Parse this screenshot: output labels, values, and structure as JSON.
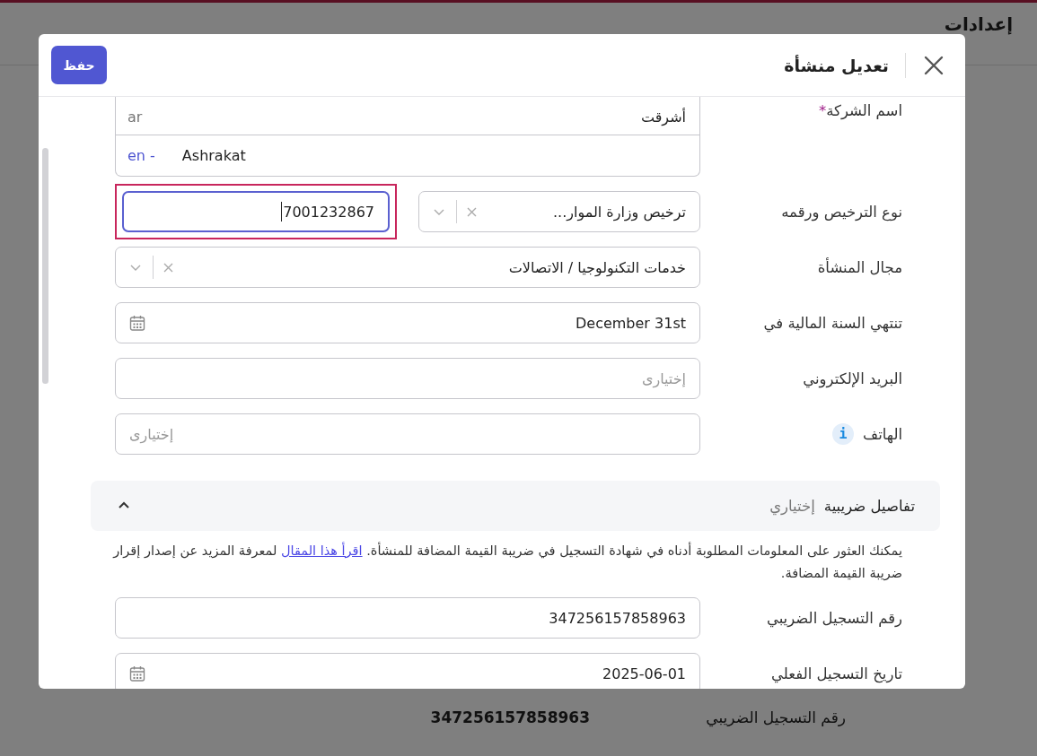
{
  "page": {
    "title": "إعدادات",
    "rows": [
      {
        "label": "رقم التسجيل الضريبي",
        "value": "347256157858963"
      }
    ]
  },
  "dialog": {
    "title": "تعديل منشأة",
    "save_button": "حفظ",
    "fields": [
      {
        "kind": "multilang",
        "label": "اسم الشركة",
        "required_mark": "*",
        "entries": [
          {
            "lang": "ar",
            "value": "أشرقت"
          },
          {
            "lang": "en -",
            "value": "Ashrakat"
          }
        ]
      },
      {
        "kind": "select_input",
        "label": "نوع الترخيص ورقمه",
        "select": {
          "value": "ترخيص وزارة الموار..."
        },
        "input": {
          "value": "7001232867",
          "focused": true,
          "highlighted": true
        }
      },
      {
        "kind": "select",
        "label": "مجال المنشأة",
        "value": "خدمات التكنولوجيا / الاتصالات"
      },
      {
        "kind": "date",
        "label": "تنتهي السنة المالية في",
        "value": "December 31st"
      },
      {
        "kind": "text",
        "label": "البريد الإلكتروني",
        "placeholder": "إختيارى"
      },
      {
        "kind": "text",
        "label": "الهاتف",
        "info": "i",
        "ltr": true,
        "placeholder": "إختيارى"
      }
    ],
    "tax_section": {
      "title": "تفاصيل ضريبية",
      "hint": "إختياري",
      "expanded": true,
      "description": "يمكنك العثور على المعلومات المطلوبة أدناه في شهادة التسجيل في ضريبة القيمة المضافة للمنشأة.",
      "link": "اقرأ هذا المقال",
      "description_end": "لمعرفة المزيد عن إصدار إقرار ضريبة القيمة المضافة.",
      "fields": [
        {
          "kind": "text",
          "label": "رقم التسجيل الضريبي",
          "value": "347256157858963"
        },
        {
          "kind": "date",
          "label": "تاريخ التسجيل الفعلي",
          "value": "2025-06-01"
        }
      ]
    }
  }
}
